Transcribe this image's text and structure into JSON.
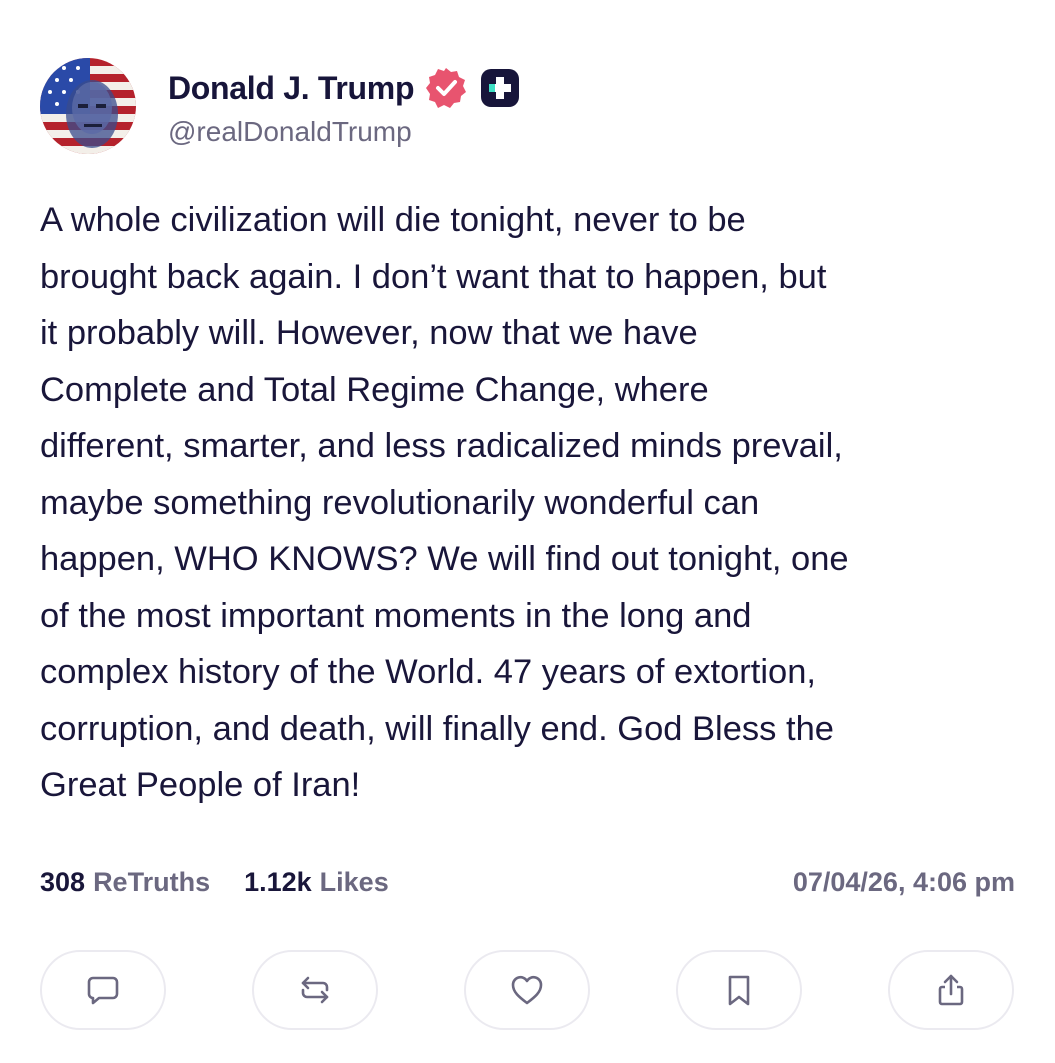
{
  "post": {
    "author": {
      "display_name": "Donald J. Trump",
      "handle": "@realDonaldTrump",
      "verified_badge_color": "#e8546f"
    },
    "text": "A whole civilization will die tonight, never to be\nbrought back again. I don’t want that to happen, but\nit probably will. However, now that we have\nComplete and Total Regime Change, where\ndifferent, smarter, and less radicalized minds prevail,\nmaybe something revolutionarily wonderful can\nhappen, WHO KNOWS? We will find out tonight, one\nof the most important moments in the long and\ncomplex history of the World. 47 years of extortion,\ncorruption, and death, will finally end. God Bless the\nGreat People of Iran!",
    "stats": {
      "retruths_count": "308",
      "retruths_label": "ReTruths",
      "likes_count": "1.12k",
      "likes_label": "Likes"
    },
    "timestamp": "07/04/26, 4:06 pm",
    "actions": [
      {
        "icon": "reply-icon"
      },
      {
        "icon": "retruth-icon"
      },
      {
        "icon": "heart-icon"
      },
      {
        "icon": "bookmark-icon"
      },
      {
        "icon": "share-icon"
      }
    ]
  }
}
